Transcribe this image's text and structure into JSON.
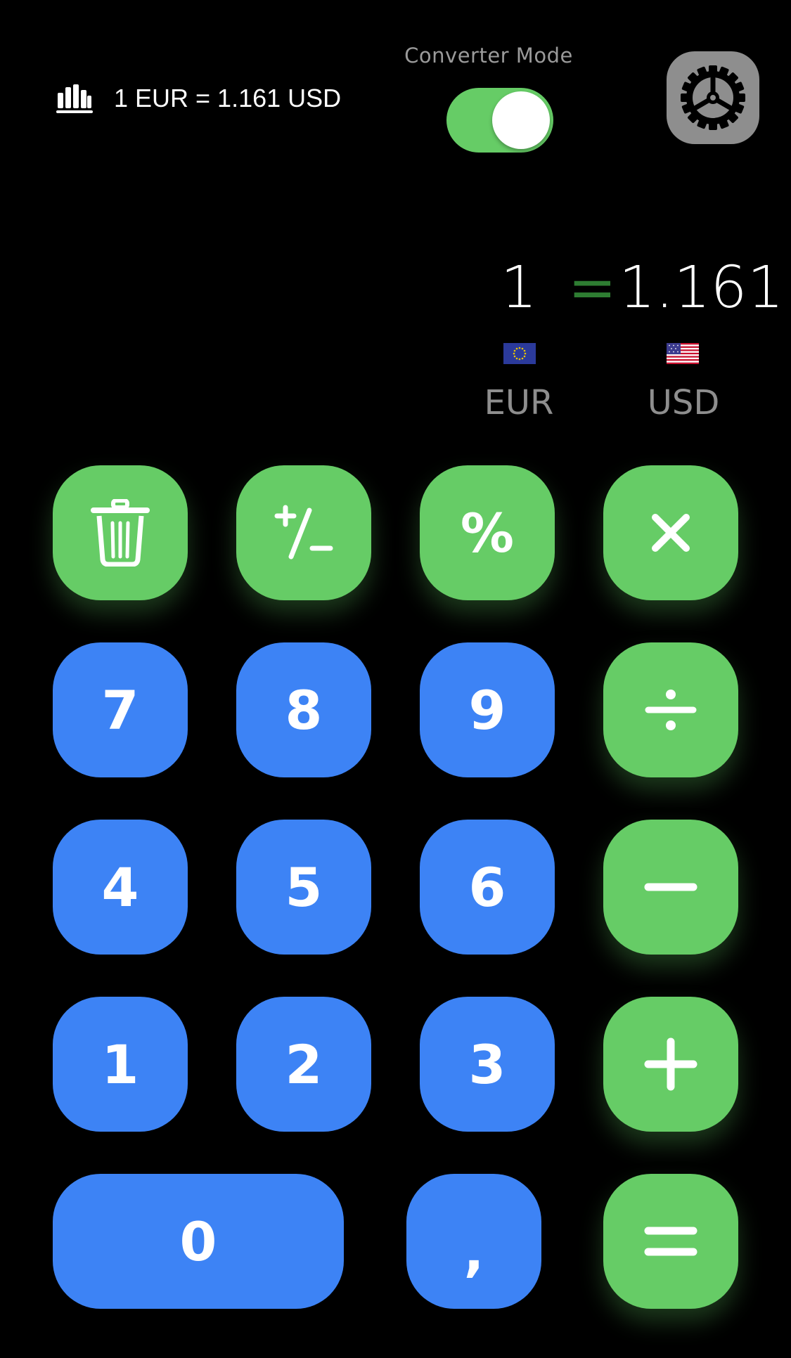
{
  "header": {
    "rate_text": "1 EUR = 1.161 USD",
    "rate_icon": "bar-chart-icon",
    "mode_label": "Converter Mode",
    "mode_toggle_on": true,
    "settings_icon": "gear-icon"
  },
  "display": {
    "from_amount": "1",
    "equals": "=",
    "to_amount": "1.161",
    "from_currency": "EUR",
    "to_currency": "USD",
    "from_flag": "eu-flag-icon",
    "to_flag": "us-flag-icon"
  },
  "keypad": {
    "row1": [
      {
        "icon": "trash-icon"
      },
      {
        "label": "+/−",
        "icon": "plus-minus-icon"
      },
      {
        "label": "%"
      },
      {
        "label": "×",
        "icon": "multiply-icon"
      }
    ],
    "row2": [
      {
        "label": "7"
      },
      {
        "label": "8"
      },
      {
        "label": "9"
      },
      {
        "label": "÷",
        "icon": "divide-icon"
      }
    ],
    "row3": [
      {
        "label": "4"
      },
      {
        "label": "5"
      },
      {
        "label": "6"
      },
      {
        "label": "−",
        "icon": "minus-icon"
      }
    ],
    "row4": [
      {
        "label": "1"
      },
      {
        "label": "2"
      },
      {
        "label": "3"
      },
      {
        "label": "+",
        "icon": "plus-icon"
      }
    ],
    "row5": [
      {
        "label": "0"
      },
      {
        "label": ","
      },
      {
        "label": "=",
        "icon": "equals-icon"
      }
    ]
  },
  "colors": {
    "operator_key": "#66cc66",
    "digit_key": "#3d83f5",
    "toggle_on": "#66cc66",
    "settings_button": "#8e8e8e",
    "equals_sign": "#2e7d32",
    "currency_label": "#8e8e8e"
  }
}
